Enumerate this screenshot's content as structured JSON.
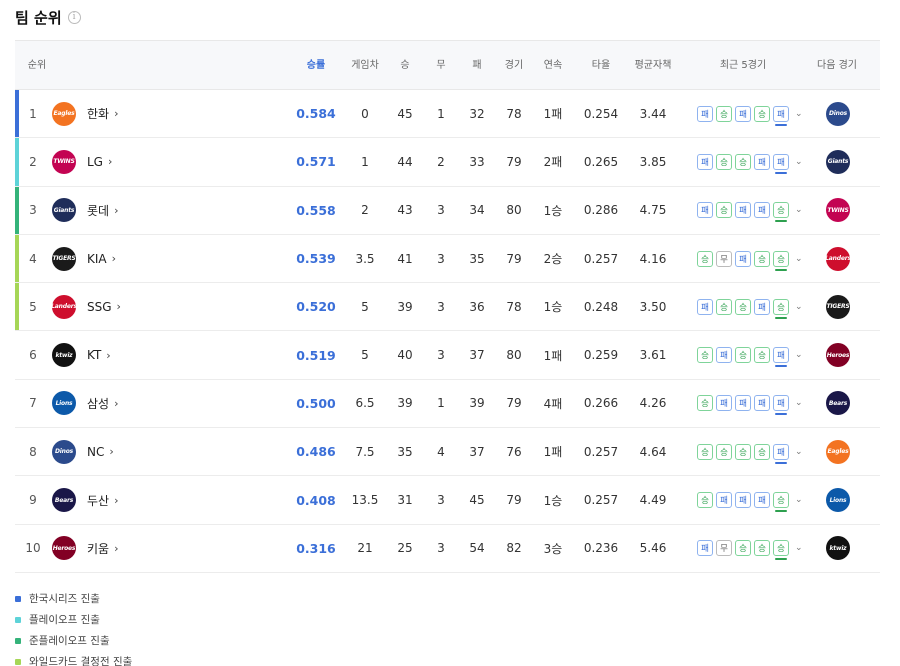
{
  "title": "팀 순위",
  "info_icon": "i",
  "colors": {
    "korean_series": "#3b6fd8",
    "playoff": "#5dd3d8",
    "semi_playoff": "#34b37a",
    "wildcard": "#a6d657",
    "win": "#2ea04f",
    "loss": "#3b6fd8",
    "draw": "#888888"
  },
  "headers": {
    "rank": "순위",
    "win_pct": "승률",
    "games_behind": "게임차",
    "wins": "승",
    "draws": "무",
    "losses": "패",
    "games": "경기",
    "streak": "연속",
    "batting_avg": "타율",
    "era": "평균자책",
    "recent5": "최근 5경기",
    "next_game": "다음 경기"
  },
  "rows": [
    {
      "rank": "1",
      "team": "한화",
      "logo": "Eagles",
      "pct": "0.584",
      "gb": "0",
      "w": "45",
      "d": "1",
      "l": "32",
      "g": "78",
      "streak": "1패",
      "avg": "0.254",
      "era": "3.44",
      "recent": [
        "패",
        "승",
        "패",
        "승",
        "패"
      ],
      "next": "Dinos",
      "zone": "korean_series"
    },
    {
      "rank": "2",
      "team": "LG",
      "logo": "TWINS",
      "pct": "0.571",
      "gb": "1",
      "w": "44",
      "d": "2",
      "l": "33",
      "g": "79",
      "streak": "2패",
      "avg": "0.265",
      "era": "3.85",
      "recent": [
        "패",
        "승",
        "승",
        "패",
        "패"
      ],
      "next": "Giants",
      "zone": "playoff"
    },
    {
      "rank": "3",
      "team": "롯데",
      "logo": "Giants",
      "pct": "0.558",
      "gb": "2",
      "w": "43",
      "d": "3",
      "l": "34",
      "g": "80",
      "streak": "1승",
      "avg": "0.286",
      "era": "4.75",
      "recent": [
        "패",
        "승",
        "패",
        "패",
        "승"
      ],
      "next": "TWINS",
      "zone": "semi_playoff"
    },
    {
      "rank": "4",
      "team": "KIA",
      "logo": "TIGERS",
      "pct": "0.539",
      "gb": "3.5",
      "w": "41",
      "d": "3",
      "l": "35",
      "g": "79",
      "streak": "2승",
      "avg": "0.257",
      "era": "4.16",
      "recent": [
        "승",
        "무",
        "패",
        "승",
        "승"
      ],
      "next": "Landers",
      "zone": "wildcard"
    },
    {
      "rank": "5",
      "team": "SSG",
      "logo": "Landers",
      "pct": "0.520",
      "gb": "5",
      "w": "39",
      "d": "3",
      "l": "36",
      "g": "78",
      "streak": "1승",
      "avg": "0.248",
      "era": "3.50",
      "recent": [
        "패",
        "승",
        "승",
        "패",
        "승"
      ],
      "next": "TIGERS",
      "zone": "wildcard"
    },
    {
      "rank": "6",
      "team": "KT",
      "logo": "ktwiz",
      "pct": "0.519",
      "gb": "5",
      "w": "40",
      "d": "3",
      "l": "37",
      "g": "80",
      "streak": "1패",
      "avg": "0.259",
      "era": "3.61",
      "recent": [
        "승",
        "패",
        "승",
        "승",
        "패"
      ],
      "next": "Heroes",
      "zone": ""
    },
    {
      "rank": "7",
      "team": "삼성",
      "logo": "Lions",
      "pct": "0.500",
      "gb": "6.5",
      "w": "39",
      "d": "1",
      "l": "39",
      "g": "79",
      "streak": "4패",
      "avg": "0.266",
      "era": "4.26",
      "recent": [
        "승",
        "패",
        "패",
        "패",
        "패"
      ],
      "next": "Bears",
      "zone": ""
    },
    {
      "rank": "8",
      "team": "NC",
      "logo": "Dinos",
      "pct": "0.486",
      "gb": "7.5",
      "w": "35",
      "d": "4",
      "l": "37",
      "g": "76",
      "streak": "1패",
      "avg": "0.257",
      "era": "4.64",
      "recent": [
        "승",
        "승",
        "승",
        "승",
        "패"
      ],
      "next": "Eagles",
      "zone": ""
    },
    {
      "rank": "9",
      "team": "두산",
      "logo": "Bears",
      "pct": "0.408",
      "gb": "13.5",
      "w": "31",
      "d": "3",
      "l": "45",
      "g": "79",
      "streak": "1승",
      "avg": "0.257",
      "era": "4.49",
      "recent": [
        "승",
        "패",
        "패",
        "패",
        "승"
      ],
      "next": "Lions",
      "zone": ""
    },
    {
      "rank": "10",
      "team": "키움",
      "logo": "Heroes",
      "pct": "0.316",
      "gb": "21",
      "w": "25",
      "d": "3",
      "l": "54",
      "g": "82",
      "streak": "3승",
      "avg": "0.236",
      "era": "5.46",
      "recent": [
        "패",
        "무",
        "승",
        "승",
        "승"
      ],
      "next": "ktwiz",
      "zone": ""
    }
  ],
  "logo_colors": {
    "Eagles": "#f37321",
    "TWINS": "#c30452",
    "Giants": "#1f2d5a",
    "TIGERS": "#1a1a1a",
    "Landers": "#ce0e2d",
    "ktwiz": "#111111",
    "Lions": "#0c59a9",
    "Dinos": "#2b4a8c",
    "Bears": "#1a1748",
    "Heroes": "#820024"
  },
  "legend": [
    {
      "label": "한국시리즈 진출",
      "zone": "korean_series"
    },
    {
      "label": "플레이오프 진출",
      "zone": "playoff"
    },
    {
      "label": "준플레이오프 진출",
      "zone": "semi_playoff"
    },
    {
      "label": "와일드카드 결정전 진출",
      "zone": "wildcard"
    }
  ]
}
